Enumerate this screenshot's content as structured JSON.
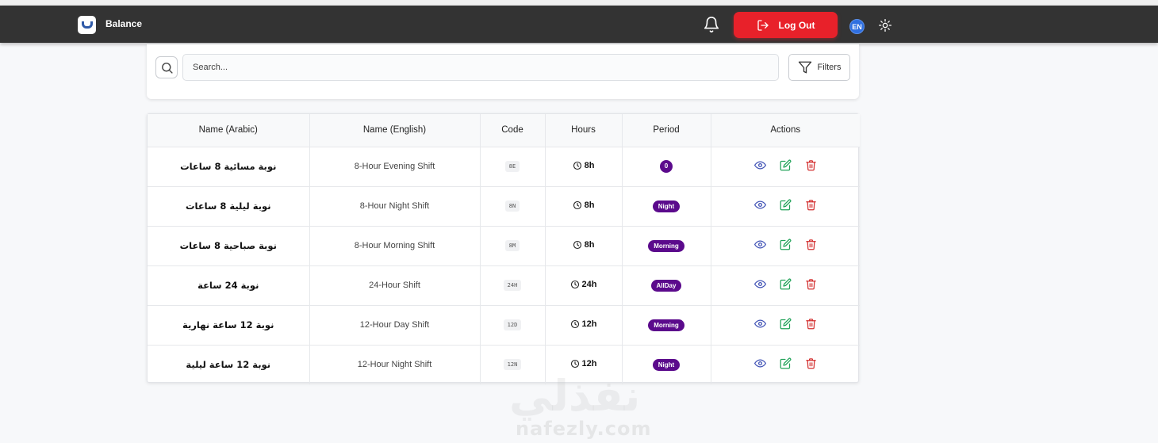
{
  "app": {
    "brand": "Balance"
  },
  "header": {
    "logout_label": "Log Out",
    "language": "EN"
  },
  "search": {
    "placeholder": "Search...",
    "filters_label": "Filters"
  },
  "table": {
    "columns": [
      "Name (Arabic)",
      "Name (English)",
      "Code",
      "Hours",
      "Period",
      "Actions"
    ],
    "rows": [
      {
        "name_ar": "نوبة مسائية 8 ساعات",
        "name_en": "8-Hour Evening Shift",
        "code": "8E",
        "hours": "8h",
        "period": "0"
      },
      {
        "name_ar": "نوبة ليلية 8 ساعات",
        "name_en": "8-Hour Night Shift",
        "code": "8N",
        "hours": "8h",
        "period": "Night"
      },
      {
        "name_ar": "نوبة صباحية 8 ساعات",
        "name_en": "8-Hour Morning Shift",
        "code": "8M",
        "hours": "8h",
        "period": "Morning"
      },
      {
        "name_ar": "نوبة 24 ساعة",
        "name_en": "24-Hour Shift",
        "code": "24H",
        "hours": "24h",
        "period": "AllDay"
      },
      {
        "name_ar": "نوبة 12 ساعة نهارية",
        "name_en": "12-Hour Day Shift",
        "code": "12D",
        "hours": "12h",
        "period": "Morning"
      },
      {
        "name_ar": "نوبة 12 ساعة ليلية",
        "name_en": "12-Hour Night Shift",
        "code": "12N",
        "hours": "12h",
        "period": "Night"
      }
    ]
  },
  "watermark": {
    "arabic": "نفذلي",
    "latin": "nafezly.com"
  },
  "colors": {
    "navbar": "#333333",
    "logout": "#e8212a",
    "period_badge": "#5b0a8c",
    "view_icon": "#3f51b5",
    "edit_icon": "#22a35a",
    "delete_icon": "#d32f2f"
  }
}
